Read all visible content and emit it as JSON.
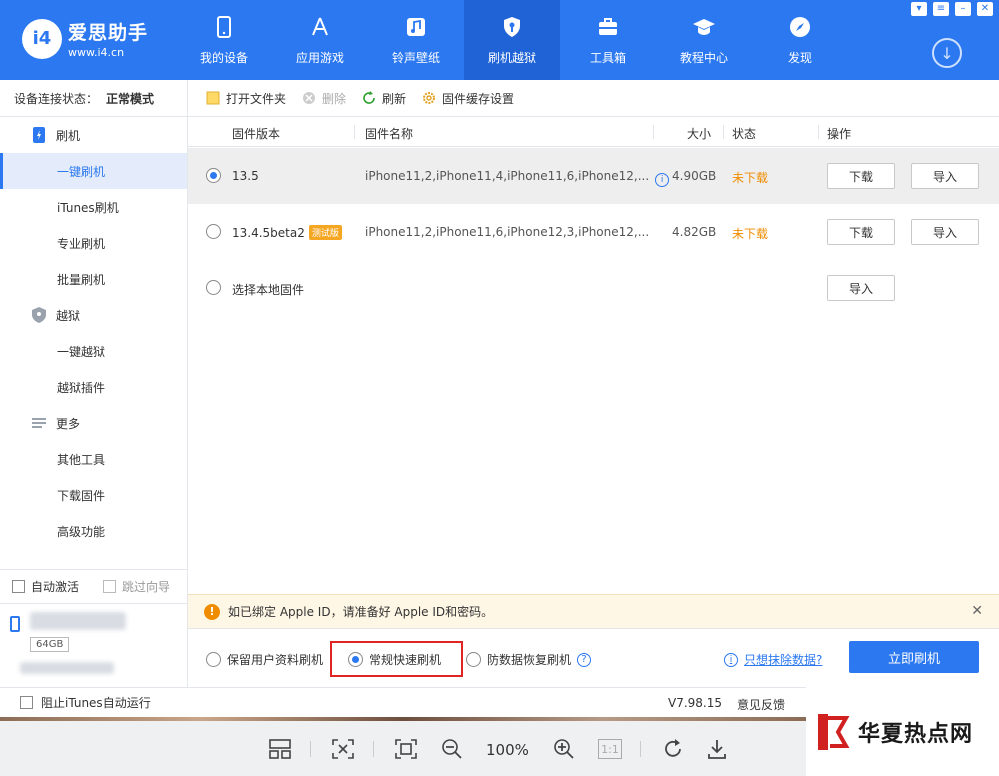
{
  "app": {
    "logo_badge": "i4",
    "logo_name": "爱思助手",
    "logo_url": "www.i4.cn"
  },
  "nav": [
    {
      "label": "我的设备",
      "icon": "phone-icon"
    },
    {
      "label": "应用游戏",
      "icon": "app-store-icon"
    },
    {
      "label": "铃声壁纸",
      "icon": "music-icon"
    },
    {
      "label": "刷机越狱",
      "icon": "shield-key-icon",
      "active": true
    },
    {
      "label": "工具箱",
      "icon": "toolbox-icon"
    },
    {
      "label": "教程中心",
      "icon": "graduation-cap-icon"
    },
    {
      "label": "发现",
      "icon": "compass-icon"
    }
  ],
  "sidebar": {
    "conn_label": "设备连接状态：",
    "conn_value": "正常模式",
    "groups": [
      {
        "label": "刷机",
        "icon": "flash-phone-icon"
      },
      {
        "label": "越狱",
        "icon": "jailbreak-shield-icon"
      },
      {
        "label": "更多",
        "icon": "more-list-icon"
      }
    ],
    "items": [
      "一键刷机",
      "iTunes刷机",
      "专业刷机",
      "批量刷机",
      "一键越狱",
      "越狱插件",
      "其他工具",
      "下载固件",
      "高级功能"
    ],
    "auto_activate": "自动激活",
    "skip_guide": "跳过向导",
    "device_capacity": "64GB"
  },
  "toolbar": {
    "open_folder": "打开文件夹",
    "delete": "删除",
    "refresh": "刷新",
    "cache_settings": "固件缓存设置"
  },
  "table": {
    "headers": {
      "version": "固件版本",
      "name": "固件名称",
      "size": "大小",
      "status": "状态",
      "action": "操作"
    },
    "rows": [
      {
        "version": "13.5",
        "name": "iPhone11,2,iPhone11,4,iPhone11,6,iPhone12,...",
        "size": "4.90GB",
        "status": "未下载",
        "download": "下载",
        "import": "导入"
      },
      {
        "version": "13.4.5beta2",
        "beta": "测试版",
        "name": "iPhone11,2,iPhone11,6,iPhone12,3,iPhone12,...",
        "size": "4.82GB",
        "status": "未下载",
        "download": "下载",
        "import": "导入"
      }
    ],
    "local": {
      "label": "选择本地固件",
      "import": "导入"
    }
  },
  "notice": {
    "text": "如已绑定 Apple ID，请准备好 Apple ID和密码。",
    "close": "✕"
  },
  "modes": {
    "keep_data": "保留用户资料刷机",
    "quick": "常规快速刷机",
    "anti_recovery": "防数据恢复刷机",
    "erase_link": "只想抹除数据?",
    "flash_now": "立即刷机"
  },
  "statusbar": {
    "block_itunes": "阻止iTunes自动运行",
    "version": "V7.98.15",
    "feedback": "意见反馈"
  },
  "viewer": {
    "zoom": "100%",
    "actual_size": "1:1"
  },
  "watermark": {
    "text": "华夏热点网"
  }
}
